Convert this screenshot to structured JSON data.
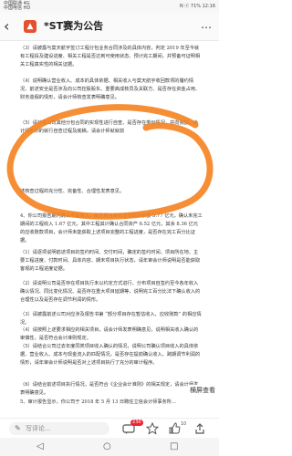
{
  "status": {
    "left_line1": "中国联通 4G",
    "left_line2": "中国电信 HD",
    "right_text": "N ⓔ 71% 12:16"
  },
  "header": {
    "back_icon": "arrow-left",
    "app_icon": "▲",
    "title": "*ST赛为公告",
    "more_icon": "…"
  },
  "document": {
    "paragraphs": [
      "（3）请披露与莫天航宇签订工程分包业务合同涉及的具体内容，判定 2019 年至今就有工程投及建设进度、相关工程是否达到可使用状态、预计完工期间，并预备可证明相关工程真实性的相关证据。",
      "（4）说明确认营业收入、成本的具体依据、相关收入与莫天航宇收回款项的履约情况、前述安全是否涉及向公司控股股东、重要高成核员及关联方、是否存在资金占用、财务造假的情形，请会计师核查发表明确意见。",
      "（5）请补充公司其他分包合同的实现性进行自查、是否存在类似情况，并向我部、会计师就你的就行自查过程及底稿，请会计师就就前",
      "述核查过程的充分性、完备性、合理性发表意见。",
      "4、你公司报告期内确认项目收入，截至报告期末应收款项余额 5.77 亿元，确认未完工期间的工程收入 1.67 亿元，其中工程其计确认合同资产 6.52 亿元，其余 8.36 亿元的应收账款项目，会计师未能获取上述项目完整的工程进度，是否存在完工百分比证据。",
      "（1）请逐项说明前述项目的签约时间、交付时间，确定的签约时间、项目所在地、主要工程进度、付款时间、具体内容、期末项目执行状态，请年审会计师说明是否能获取客观的工程进度证据。",
      "（2）请说明公司是否存在项目执行未以约定方式进行、分布项目自签约至今各年收入确认情况、同比变化情况、是否存在重大项目延期等，说明完工百分比法下确认收入的合理性以及是否存在调节利润的情形。",
      "（3）请披露前述公司对应涉及报告书第 “部分项目存在暂估收入、应收账款” 的相应情况。",
      "（4）请按照上述要求相应的相关项目，请会计师发表明确意见，说明相关收入确认的审慎性，是否符合会计准则规定。",
      "（5）请结合公司过去年度同类项目收入确认的情况，说明公司确认项目收入的具体依据、营业收入、成本与现金流入的匹配情况，是否存在提前确认收入、跨期调节利润的情形，请年审会计师说明是否对上述项目执行了充分的审计程序。",
      "（6）请结合前述项目执行情况，是否符合《企业会计准则》的相关规定，请会计师发表明确意见。",
      "5、审计报告显示，你公司于 2018 年 5 月 13 日聘任立信会计师事务所..."
    ]
  },
  "floating": {
    "label": "横屏查看"
  },
  "bottom_bar": {
    "comment_placeholder": "写评论...",
    "comment_count_badge": "230",
    "share_count": "10"
  },
  "colors": {
    "annotation_stroke": "#f58220",
    "badge": "#e23b3b",
    "app_icon_bg": "#e5502e"
  }
}
